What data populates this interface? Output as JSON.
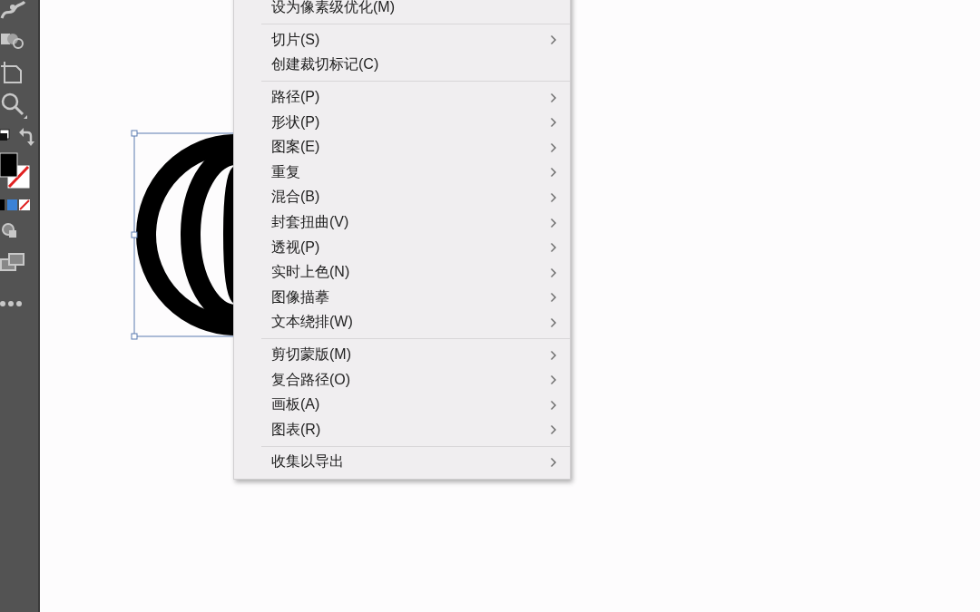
{
  "menu": {
    "groups": [
      {
        "items": [
          {
            "label": "设为像素级优化(M)",
            "submenu": false
          }
        ]
      },
      {
        "items": [
          {
            "label": "切片(S)",
            "submenu": true
          },
          {
            "label": "创建裁切标记(C)",
            "submenu": false
          }
        ]
      },
      {
        "items": [
          {
            "label": "路径(P)",
            "submenu": true
          },
          {
            "label": "形状(P)",
            "submenu": true
          },
          {
            "label": "图案(E)",
            "submenu": true
          },
          {
            "label": "重复",
            "submenu": true
          },
          {
            "label": "混合(B)",
            "submenu": true
          },
          {
            "label": "封套扭曲(V)",
            "submenu": true
          },
          {
            "label": "透视(P)",
            "submenu": true
          },
          {
            "label": "实时上色(N)",
            "submenu": true
          },
          {
            "label": "图像描摹",
            "submenu": true
          },
          {
            "label": "文本绕排(W)",
            "submenu": true
          }
        ]
      },
      {
        "items": [
          {
            "label": "剪切蒙版(M)",
            "submenu": true
          },
          {
            "label": "复合路径(O)",
            "submenu": true
          },
          {
            "label": "画板(A)",
            "submenu": true
          },
          {
            "label": "图表(R)",
            "submenu": true
          }
        ]
      },
      {
        "items": [
          {
            "label": "收集以导出",
            "submenu": true
          }
        ]
      }
    ]
  }
}
